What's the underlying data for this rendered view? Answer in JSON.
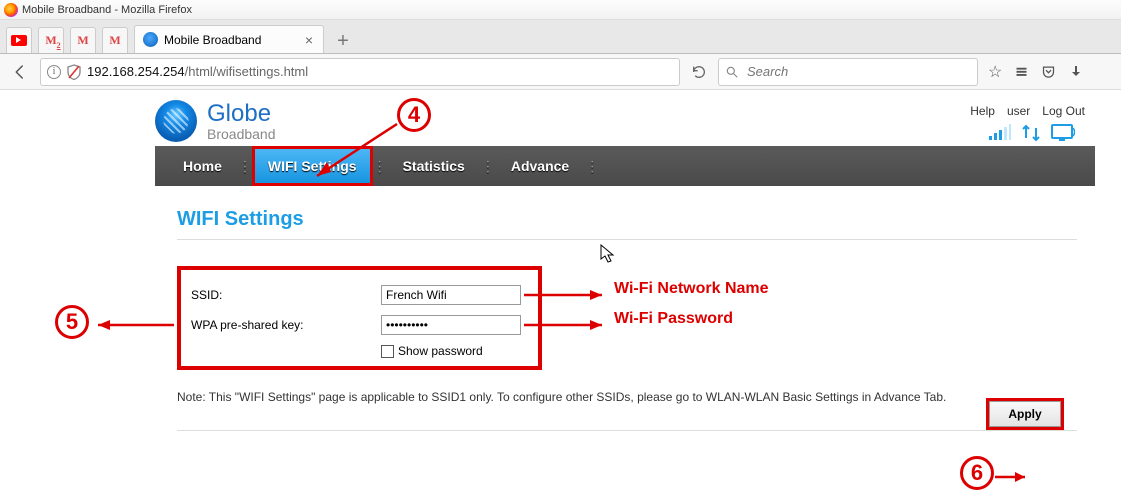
{
  "window": {
    "title": "Mobile Broadband - Mozilla Firefox"
  },
  "tabs": {
    "active_label": "Mobile Broadband"
  },
  "urlbar": {
    "host": "192.168.254.254",
    "path": "/html/wifisettings.html"
  },
  "search": {
    "placeholder": "Search"
  },
  "top_links": {
    "help": "Help",
    "user": "user",
    "logout": "Log Out"
  },
  "brand": {
    "name": "Globe",
    "sub": "Broadband"
  },
  "nav": {
    "home": "Home",
    "wifi": "WIFI Settings",
    "stats": "Statistics",
    "advance": "Advance"
  },
  "page_content": {
    "heading": "WIFI Settings",
    "ssid_label": "SSID:",
    "ssid_value": "French Wifi",
    "wpa_label": "WPA pre-shared key:",
    "wpa_value": "••••••••••",
    "show_pw_label": "Show password",
    "note": "Note: This \"WIFI Settings\" page is applicable to SSID1 only. To configure other SSIDs, please go to WLAN-WLAN Basic Settings in Advance Tab.",
    "apply": "Apply"
  },
  "annotations": {
    "n4": "4",
    "n5": "5",
    "n6": "6",
    "ssid_hint": "Wi-Fi Network Name",
    "wpa_hint": "Wi-Fi Password"
  }
}
